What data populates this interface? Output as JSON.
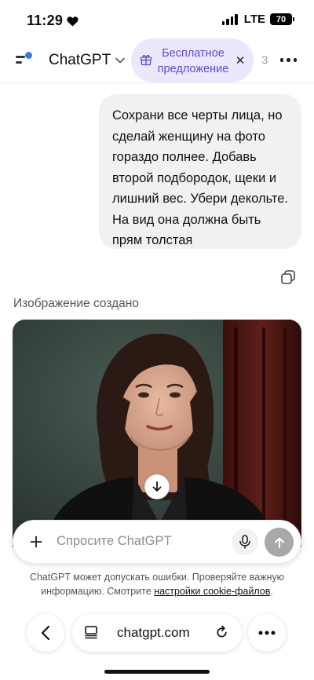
{
  "status_bar": {
    "time": "11:29",
    "network": "LTE",
    "battery": "70"
  },
  "header": {
    "model_name": "ChatGPT",
    "promo_label": "Бесплатное предложение",
    "overflow_fragment": "З"
  },
  "conversation": {
    "user_message": "Сохрани все черты лица, но сделай женщину на фото гораздо полнее. Добавь второй подбородок, щеки и лишний вес. Убери декольте. На вид она должна быть прям толстая",
    "generated_label": "Изображение создано"
  },
  "composer": {
    "placeholder": "Спросите ChatGPT"
  },
  "disclaimer": {
    "text": "ChatGPT может допускать ошибки. Проверяйте важную информацию. Смотрите ",
    "link": "настройки cookie-файлов",
    "suffix": "."
  },
  "browser": {
    "url": "chatgpt.com"
  },
  "colors": {
    "accent": "#5b4bd9",
    "promo_bg": "#ebe8fb",
    "notification_dot": "#2f7ff6",
    "bubble_bg": "#f1f1f1"
  }
}
